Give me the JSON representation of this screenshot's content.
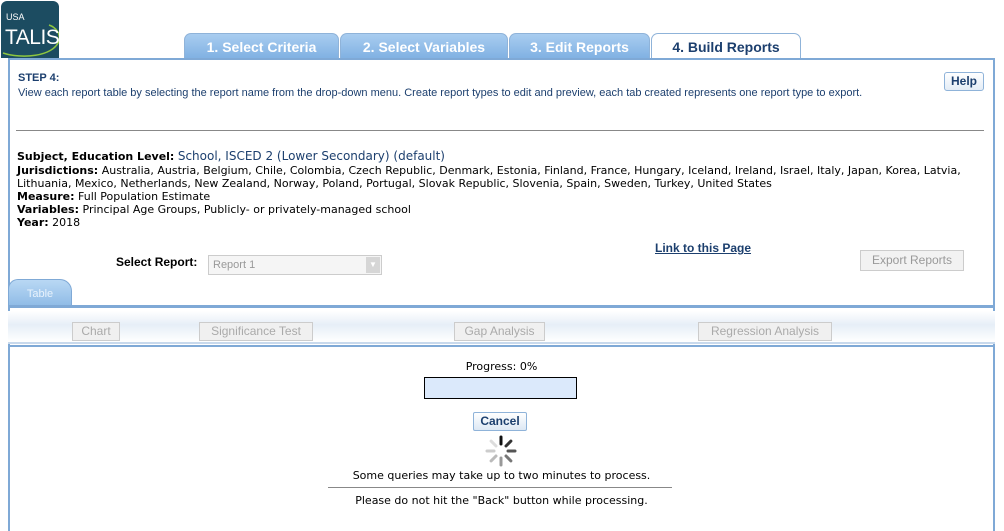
{
  "logo": {
    "line1": "USA",
    "line2": "TALIS"
  },
  "tabs": [
    {
      "label": "1. Select Criteria",
      "active": false
    },
    {
      "label": "2. Select Variables",
      "active": false
    },
    {
      "label": "3. Edit Reports",
      "active": false
    },
    {
      "label": "4. Build Reports",
      "active": true
    }
  ],
  "step": {
    "title": "STEP 4:",
    "description": "View each report table by selecting the report name from the drop-down menu. Create report types to edit and preview, each tab created represents one report type to export.",
    "help_label": "Help"
  },
  "criteria": {
    "subject_label": "Subject, Education Level:",
    "subject_value": "School, ISCED 2 (Lower Secondary) (default)",
    "jurisdictions_label": "Jurisdictions:",
    "jurisdictions_value": "Australia, Austria, Belgium, Chile, Colombia, Czech Republic, Denmark, Estonia, Finland, France, Hungary, Iceland, Ireland, Israel, Italy, Japan, Korea, Latvia, Lithuania, Mexico, Netherlands, New Zealand, Norway, Poland, Portugal, Slovak Republic, Slovenia, Spain, Sweden, Turkey, United States",
    "measure_label": "Measure:",
    "measure_value": "Full Population Estimate",
    "variables_label": "Variables:",
    "variables_value": "Principal Age Groups, Publicly- or privately-managed school",
    "year_label": "Year:",
    "year_value": "2018"
  },
  "report": {
    "link_label": "Link to this Page",
    "export_label": "Export Reports",
    "select_label": "Select Report:",
    "selected_value": "Report 1",
    "table_tab_label": "Table"
  },
  "toolbar": {
    "chart_label": "Chart",
    "significance_label": "Significance Test",
    "gap_label": "Gap Analysis",
    "regression_label": "Regression Analysis"
  },
  "progress": {
    "label": "Progress: 0%",
    "value": 0,
    "cancel_label": "Cancel",
    "note1": "Some queries may take up to two minutes to process.",
    "note2": "Please do not hit the \"Back\" button while processing."
  },
  "colors": {
    "brand_navy": "#1c3f6e",
    "tab_blue": "#7fb0e2",
    "panel_border": "#7fa9d6"
  }
}
